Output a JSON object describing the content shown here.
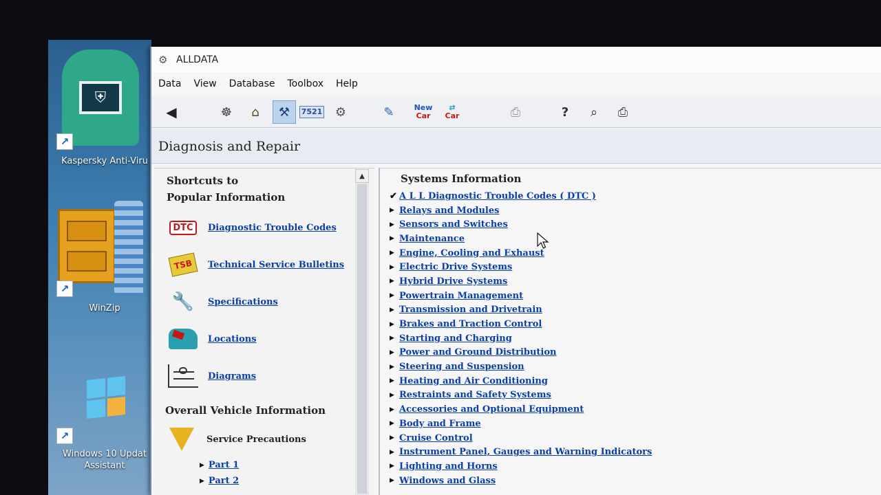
{
  "desktop": {
    "icons": [
      {
        "label": "Kaspersky Anti-Viru",
        "icon": "kaspersky-monitor-icon"
      },
      {
        "label": "WinZip",
        "icon": "winzip-cabinet-icon"
      },
      {
        "label": "Windows 10 Updat Assistant",
        "icon": "windows-logo-icon"
      }
    ]
  },
  "window": {
    "title": "ALLDATA",
    "menu": [
      "Data",
      "View",
      "Database",
      "Toolbox",
      "Help"
    ],
    "toolbar": {
      "dtc_text": "7521",
      "new_car_line1": "New",
      "new_car_line2": "Car",
      "car_text": "Car"
    },
    "page_title": "Diagnosis and Repair"
  },
  "left_panel": {
    "shortcuts_heading_line1": "Shortcuts to",
    "shortcuts_heading_line2": "Popular Information",
    "shortcuts": [
      {
        "label": "Diagnostic Trouble Codes",
        "icon": "dtc-icon",
        "icon_text": "DTC"
      },
      {
        "label": "Technical Service Bulletins",
        "icon": "tsb-icon",
        "icon_text": "TSB"
      },
      {
        "label": "Specifications",
        "icon": "wrench-icon"
      },
      {
        "label": "Locations",
        "icon": "car-locations-icon"
      },
      {
        "label": "Diagrams",
        "icon": "diagram-icon"
      }
    ],
    "overall_heading": "Overall Vehicle Information",
    "service_precautions": "Service Precautions",
    "parts": [
      "Part 1",
      "Part 2"
    ]
  },
  "right_panel": {
    "heading": "Systems Information",
    "items": [
      {
        "label": "A L L  Diagnostic Trouble Codes ( DTC )",
        "marker": "check"
      },
      {
        "label": "Relays and Modules",
        "marker": "triangle"
      },
      {
        "label": "Sensors and Switches",
        "marker": "triangle"
      },
      {
        "label": "Maintenance",
        "marker": "triangle"
      },
      {
        "label": "Engine, Cooling and Exhaust",
        "marker": "triangle"
      },
      {
        "label": "Electric Drive Systems",
        "marker": "triangle"
      },
      {
        "label": "Hybrid Drive Systems",
        "marker": "triangle"
      },
      {
        "label": "Powertrain Management",
        "marker": "triangle"
      },
      {
        "label": "Transmission and Drivetrain",
        "marker": "triangle"
      },
      {
        "label": "Brakes and Traction Control",
        "marker": "triangle"
      },
      {
        "label": "Starting and Charging",
        "marker": "triangle"
      },
      {
        "label": "Power and Ground Distribution",
        "marker": "triangle"
      },
      {
        "label": "Steering and Suspension",
        "marker": "triangle"
      },
      {
        "label": "Heating and Air Conditioning",
        "marker": "triangle"
      },
      {
        "label": "Restraints and Safety Systems",
        "marker": "triangle"
      },
      {
        "label": "Accessories and Optional Equipment",
        "marker": "triangle"
      },
      {
        "label": "Body and Frame",
        "marker": "triangle"
      },
      {
        "label": "Cruise Control",
        "marker": "triangle"
      },
      {
        "label": "Instrument Panel, Gauges and Warning Indicators",
        "marker": "triangle"
      },
      {
        "label": "Lighting and Horns",
        "marker": "triangle"
      },
      {
        "label": "Windows and Glass",
        "marker": "triangle"
      }
    ]
  }
}
